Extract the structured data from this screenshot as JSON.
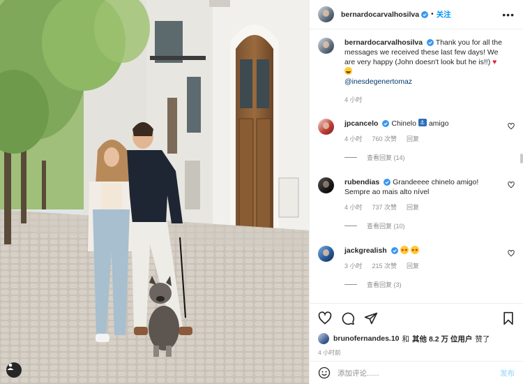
{
  "header": {
    "username": "bernardocarvalhosilva",
    "follow_label": "关注",
    "separator": "•"
  },
  "caption": {
    "username": "bernardocarvalhosilva",
    "text": "Thank you for all the messages we received these last few days! We are very happy (John doesn't look but he is!!)",
    "mention": "@inesdegenertomaz",
    "time": "4 小时"
  },
  "comments": [
    {
      "username": "jpcancelo",
      "text_before": "Chinelo",
      "text_after": "amigo",
      "time": "4 小时",
      "likes": "760 次赞",
      "reply": "回复",
      "view_replies": "查看回复 (14)",
      "avatar_color": "#c2433c"
    },
    {
      "username": "rubendias",
      "text": "Grandeeee chinelo amigo! Sempre ao mais alto nível",
      "time": "4 小时",
      "likes": "737 次赞",
      "reply": "回复",
      "view_replies": "查看回复 (10)",
      "avatar_color": "#1a1a1a"
    },
    {
      "username": "jackgrealish",
      "text": "",
      "time": "3 小时",
      "likes": "215 次赞",
      "reply": "回复",
      "view_replies": "查看回复 (3)",
      "avatar_color": "#2b5ea0"
    }
  ],
  "likes": {
    "username": "brunofernandes.10",
    "connector": "和",
    "others": "其他 8.2 万 位用户",
    "suffix": "赞了"
  },
  "post_time": "4 小时前",
  "add_comment": {
    "placeholder": "添加评论......",
    "post_label": "发布"
  },
  "icons": {
    "like": "heart-icon",
    "comment": "comment-icon",
    "share": "share-icon",
    "save": "bookmark-icon",
    "more": "more-icon",
    "emoji": "emoji-icon",
    "tag": "user-tag-icon",
    "verified": "verified-badge-icon"
  },
  "colors": {
    "accent": "#0095f6",
    "post_disabled": "#b2dffc",
    "muted": "#8e8e8e",
    "border": "#efefef",
    "verified": "#3897f0",
    "heart_emoji": "#ed1c3a"
  }
}
